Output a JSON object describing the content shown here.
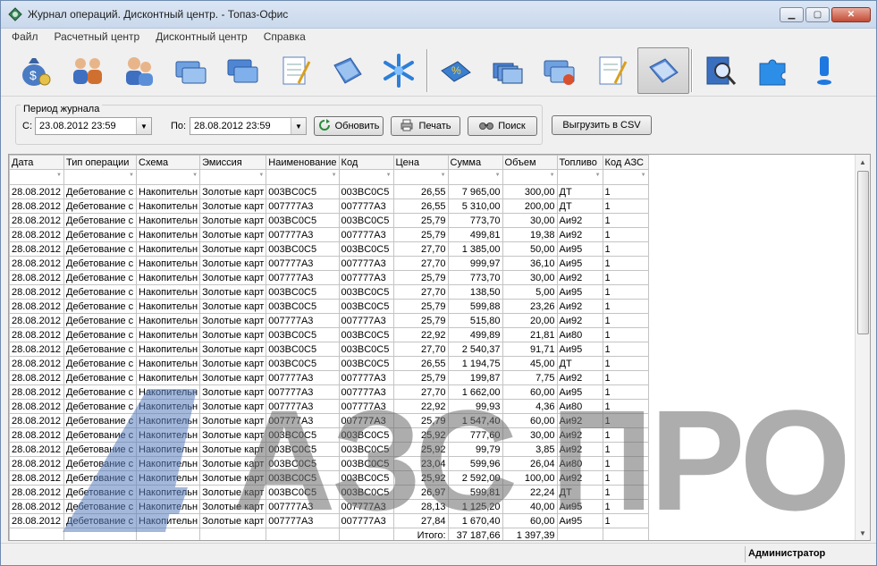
{
  "window": {
    "title": "Журнал операций. Дисконтный центр. - Топаз-Офис"
  },
  "menu": [
    "Файл",
    "Расчетный центр",
    "Дисконтный центр",
    "Справка"
  ],
  "toolbar_icons": [
    "money-bag-icon",
    "users-icon",
    "user-pair-icon",
    "cards-icon",
    "cards-blue-icon",
    "notepad-icon",
    "book-icon",
    "snowflake-icon",
    "discount-book-icon",
    "card-stack-icon",
    "cards-globe-icon",
    "notepad-pen-icon",
    "journal-icon",
    "search-book-icon",
    "puzzle-icon",
    "exclamation-icon"
  ],
  "period": {
    "legend": "Период журнала",
    "from_label": "С:",
    "from_value": "23.08.2012 23:59",
    "to_label": "По:",
    "to_value": "28.08.2012 23:59"
  },
  "buttons": {
    "refresh": "Обновить",
    "print": "Печать",
    "search": "Поиск",
    "export": "Выгрузить в CSV"
  },
  "table": {
    "columns": [
      "Дата",
      "Тип операции",
      "Схема",
      "Эмиссия",
      "Наименование",
      "Код",
      "Цена",
      "Сумма",
      "Объем",
      "Топливо",
      "Код АЗС"
    ],
    "rows": [
      [
        "28.08.2012",
        "Дебетование с",
        "Накопительн",
        "Золотые карт",
        "003BC0C5",
        "003BC0C5",
        "26,55",
        "7 965,00",
        "300,00",
        "ДТ",
        "1"
      ],
      [
        "28.08.2012",
        "Дебетование с",
        "Накопительн",
        "Золотые карт",
        "007777A3",
        "007777A3",
        "26,55",
        "5 310,00",
        "200,00",
        "ДТ",
        "1"
      ],
      [
        "28.08.2012",
        "Дебетование с",
        "Накопительн",
        "Золотые карт",
        "003BC0C5",
        "003BC0C5",
        "25,79",
        "773,70",
        "30,00",
        "Аи92",
        "1"
      ],
      [
        "28.08.2012",
        "Дебетование с",
        "Накопительн",
        "Золотые карт",
        "007777A3",
        "007777A3",
        "25,79",
        "499,81",
        "19,38",
        "Аи92",
        "1"
      ],
      [
        "28.08.2012",
        "Дебетование с",
        "Накопительн",
        "Золотые карт",
        "003BC0C5",
        "003BC0C5",
        "27,70",
        "1 385,00",
        "50,00",
        "Аи95",
        "1"
      ],
      [
        "28.08.2012",
        "Дебетование с",
        "Накопительн",
        "Золотые карт",
        "007777A3",
        "007777A3",
        "27,70",
        "999,97",
        "36,10",
        "Аи95",
        "1"
      ],
      [
        "28.08.2012",
        "Дебетование с",
        "Накопительн",
        "Золотые карт",
        "007777A3",
        "007777A3",
        "25,79",
        "773,70",
        "30,00",
        "Аи92",
        "1"
      ],
      [
        "28.08.2012",
        "Дебетование с",
        "Накопительн",
        "Золотые карт",
        "003BC0C5",
        "003BC0C5",
        "27,70",
        "138,50",
        "5,00",
        "Аи95",
        "1"
      ],
      [
        "28.08.2012",
        "Дебетование с",
        "Накопительн",
        "Золотые карт",
        "003BC0C5",
        "003BC0C5",
        "25,79",
        "599,88",
        "23,26",
        "Аи92",
        "1"
      ],
      [
        "28.08.2012",
        "Дебетование с",
        "Накопительн",
        "Золотые карт",
        "007777A3",
        "007777A3",
        "25,79",
        "515,80",
        "20,00",
        "Аи92",
        "1"
      ],
      [
        "28.08.2012",
        "Дебетование с",
        "Накопительн",
        "Золотые карт",
        "003BC0C5",
        "003BC0C5",
        "22,92",
        "499,89",
        "21,81",
        "Аи80",
        "1"
      ],
      [
        "28.08.2012",
        "Дебетование с",
        "Накопительн",
        "Золотые карт",
        "003BC0C5",
        "003BC0C5",
        "27,70",
        "2 540,37",
        "91,71",
        "Аи95",
        "1"
      ],
      [
        "28.08.2012",
        "Дебетование с",
        "Накопительн",
        "Золотые карт",
        "003BC0C5",
        "003BC0C5",
        "26,55",
        "1 194,75",
        "45,00",
        "ДТ",
        "1"
      ],
      [
        "28.08.2012",
        "Дебетование с",
        "Накопительн",
        "Золотые карт",
        "007777A3",
        "007777A3",
        "25,79",
        "199,87",
        "7,75",
        "Аи92",
        "1"
      ],
      [
        "28.08.2012",
        "Дебетование с",
        "Накопительн",
        "Золотые карт",
        "007777A3",
        "007777A3",
        "27,70",
        "1 662,00",
        "60,00",
        "Аи95",
        "1"
      ],
      [
        "28.08.2012",
        "Дебетование с",
        "Накопительн",
        "Золотые карт",
        "007777A3",
        "007777A3",
        "22,92",
        "99,93",
        "4,36",
        "Аи80",
        "1"
      ],
      [
        "28.08.2012",
        "Дебетование с",
        "Накопительн",
        "Золотые карт",
        "007777A3",
        "007777A3",
        "25,79",
        "1 547,40",
        "60,00",
        "Аи92",
        "1"
      ],
      [
        "28.08.2012",
        "Дебетование с",
        "Накопительн",
        "Золотые карт",
        "003BC0C5",
        "003BC0C5",
        "25,92",
        "777,60",
        "30,00",
        "Аи92",
        "1"
      ],
      [
        "28.08.2012",
        "Дебетование с",
        "Накопительн",
        "Золотые карт",
        "003BC0C5",
        "003BC0C5",
        "25,92",
        "99,79",
        "3,85",
        "Аи92",
        "1"
      ],
      [
        "28.08.2012",
        "Дебетование с",
        "Накопительн",
        "Золотые карт",
        "003BC0C5",
        "003BC0C5",
        "23,04",
        "599,96",
        "26,04",
        "Аи80",
        "1"
      ],
      [
        "28.08.2012",
        "Дебетование с",
        "Накопительн",
        "Золотые карт",
        "003BC0C5",
        "003BC0C5",
        "25,92",
        "2 592,00",
        "100,00",
        "Аи92",
        "1"
      ],
      [
        "28.08.2012",
        "Дебетование с",
        "Накопительн",
        "Золотые карт",
        "003BC0C5",
        "003BC0C5",
        "26,97",
        "599,81",
        "22,24",
        "ДТ",
        "1"
      ],
      [
        "28.08.2012",
        "Дебетование с",
        "Накопительн",
        "Золотые карт",
        "007777A3",
        "007777A3",
        "28,13",
        "1 125,20",
        "40,00",
        "Аи95",
        "1"
      ],
      [
        "28.08.2012",
        "Дебетование с",
        "Накопительн",
        "Золотые карт",
        "007777A3",
        "007777A3",
        "27,84",
        "1 670,40",
        "60,00",
        "Аи95",
        "1"
      ]
    ],
    "total_label": "Итого:",
    "total_sum": "37 187,66",
    "total_volume": "1 397,39"
  },
  "watermark": "АЗС ПРО",
  "status": {
    "user": "Администратор"
  },
  "colors": {
    "titlebar": "#c9d8ec",
    "watermark_blue": "#5a7fbf",
    "watermark_gray": "#6b6b6b"
  }
}
